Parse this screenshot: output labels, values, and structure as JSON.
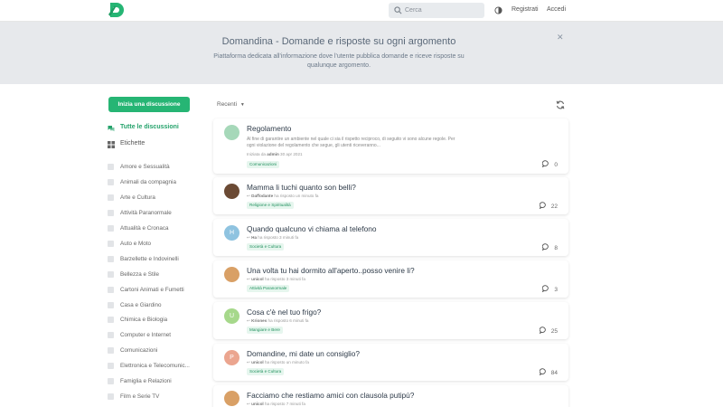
{
  "header": {
    "search_placeholder": "Cerca",
    "signup_label": "Registrati",
    "login_label": "Accedi",
    "brand_color": "#26b574"
  },
  "hero": {
    "title": "Domandina - Domande e risposte su ogni argomento",
    "description": "Piattaforma dedicata all'informazione dove l'utente pubblica domande e riceve risposte su qualunque argomento."
  },
  "sidebar": {
    "start_button": "Inizia una discussione",
    "all_discussions": "Tutte le discussioni",
    "tags_label": "Etichette",
    "tags": [
      "Amore e Sessualità",
      "Animali da compagnia",
      "Arte e Cultura",
      "Attività Paranormale",
      "Attualità e Cronaca",
      "Auto e Moto",
      "Barzellette e Indovinelli",
      "Bellezza e Stile",
      "Cartoni Animati e Fumetti",
      "Casa e Giardino",
      "Chimica e Biologia",
      "Computer e Internet",
      "Comunicazioni",
      "Elettronica e Telecomunic...",
      "Famiglia e Relazioni",
      "Film e Serie TV"
    ]
  },
  "toolbar": {
    "sort_label": "Recenti"
  },
  "discussions": [
    {
      "title": "Regolamento",
      "excerpt": "Al fine di garantire un ambiente nel quale ci sia il rispetto reciproco, di seguito vi sono alcune regole. Per ogni violazione del regolamento che segue, gli utenti riceveranno...",
      "meta_user": "admin",
      "meta_prefix": "Iniziata da",
      "meta_time": "30 apr 2021",
      "tag": "Comunicazioni",
      "replies": "0",
      "avatar_color": "#a6d8b9"
    },
    {
      "title": "Mamma li tuchi quanto son belli?",
      "meta_user": "Daffodante",
      "meta_prefix": "",
      "meta_time": "ha risposto un minuto fa",
      "tag": "Religione e Spiritualità",
      "replies": "22",
      "avatar_color": "#6b4a34"
    },
    {
      "title": "Quando qualcuno vi chiama al telefono",
      "avatar_letter": "H",
      "meta_user": "Ha",
      "meta_prefix": "",
      "meta_time": "ha risposto 3 minuti fa",
      "tag": "Società e Cultura",
      "replies": "8",
      "avatar_color": "#8fc3e0"
    },
    {
      "title": "Una volta tu hai dormito all'aperto..posso venire li?",
      "meta_user": "unicol",
      "meta_prefix": "",
      "meta_time": "ha risposto 3 minuti fa",
      "tag": "Attività Paranormale",
      "replies": "3",
      "avatar_color": "#d9a066"
    },
    {
      "title": "Cosa c'è nel tuo frigo?",
      "avatar_letter": "U",
      "meta_user": "Kriones",
      "meta_prefix": "",
      "meta_time": "ha risposto 6 minuti fa",
      "tag": "Mangiare e Bere",
      "replies": "25",
      "avatar_color": "#a6d88b"
    },
    {
      "title": "Domandine, mi date un consiglio?",
      "avatar_letter": "P",
      "meta_user": "unicol",
      "meta_prefix": "",
      "meta_time": "ha risposto un minuto fa",
      "tag": "Società e Cultura",
      "replies": "84",
      "avatar_color": "#eba58f"
    },
    {
      "title": "Facciamo che restiamo amici con clausola putipù?",
      "meta_user": "unicol",
      "meta_prefix": "",
      "meta_time": "ha risposto 7 minuti fa",
      "avatar_color": "#d9a066"
    }
  ]
}
